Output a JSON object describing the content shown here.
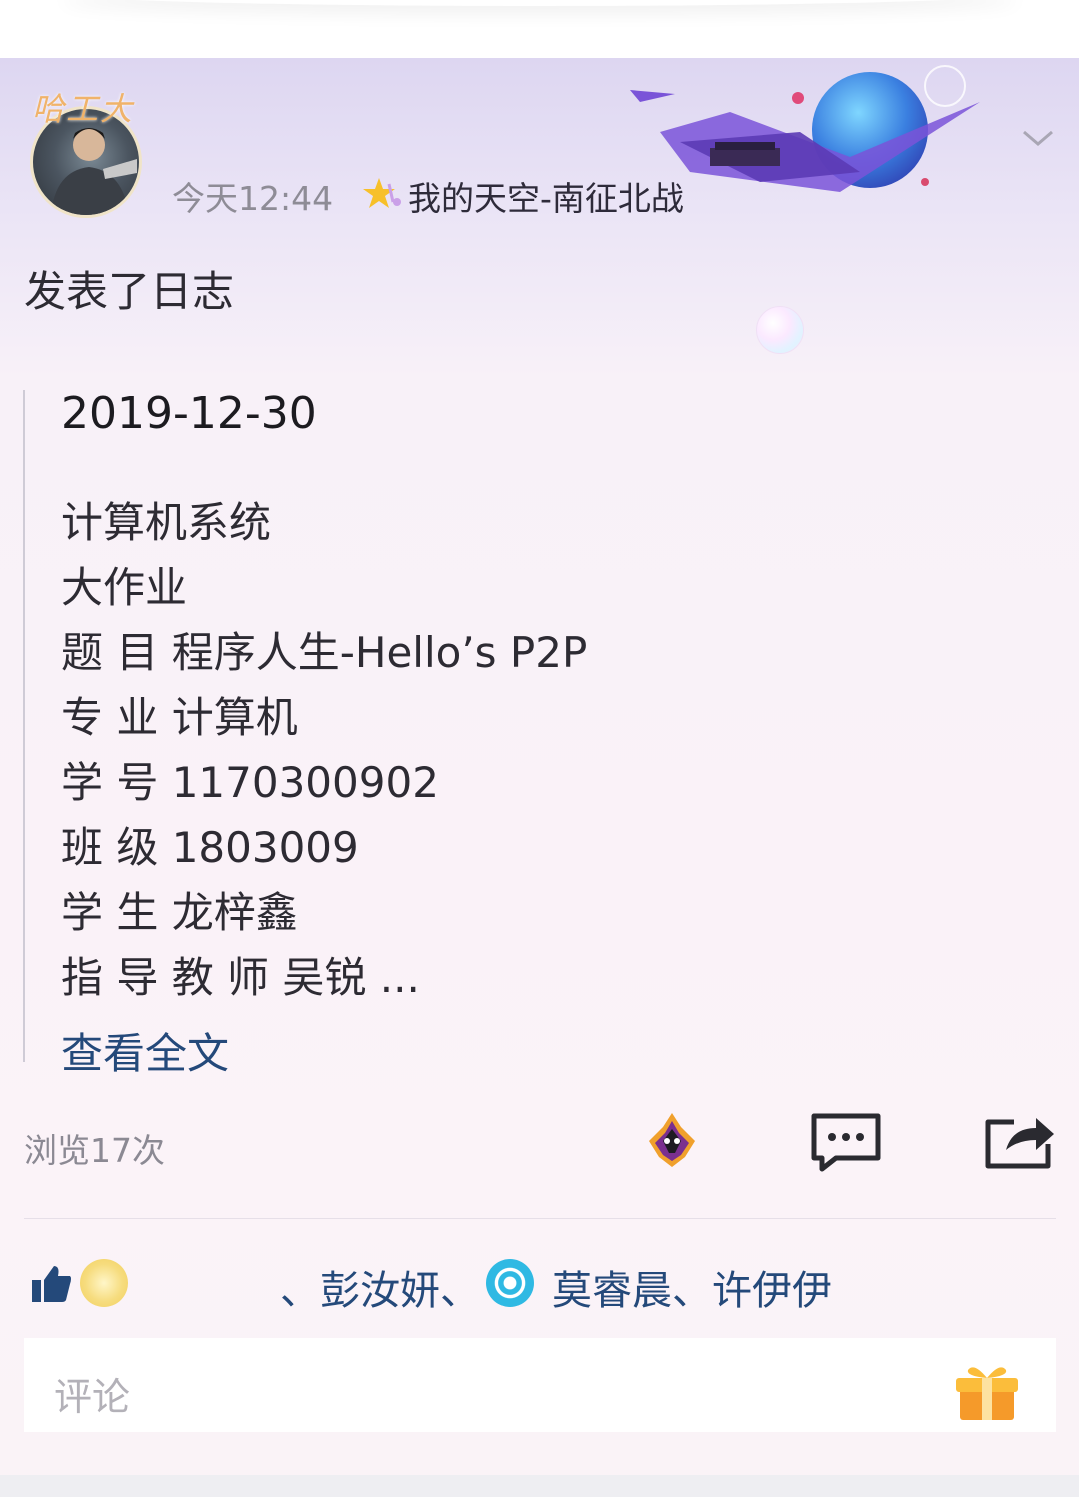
{
  "post": {
    "avatar_frame_text": "哈工大",
    "timestamp": "今天12:44",
    "space_title": "我的天空-南征北战",
    "action_text": "发表了日志"
  },
  "article": {
    "date": "2019-12-30",
    "lines": [
      "计算机系统",
      "大作业",
      "题 目 程序人生-Hello’s P2P",
      "专 业 计算机",
      "学 号 1170300902",
      "班 级 1803009",
      "学 生 龙梓鑫",
      "指 导 教 师 吴锐 ..."
    ],
    "read_more": "查看全文"
  },
  "stats": {
    "views": "浏览17次"
  },
  "likes": {
    "segment_a": "、彭汝妍、",
    "segment_b": "莫睿晨、许伊伊"
  },
  "comment": {
    "placeholder": "评论"
  },
  "icons": [
    "star-icon",
    "chevron-down-icon",
    "flame-icon",
    "comment-icon",
    "share-icon",
    "thumb-up-icon",
    "gift-icon"
  ],
  "colors": {
    "link": "#24497a",
    "muted": "#8b8993",
    "text": "#2d2b33"
  }
}
